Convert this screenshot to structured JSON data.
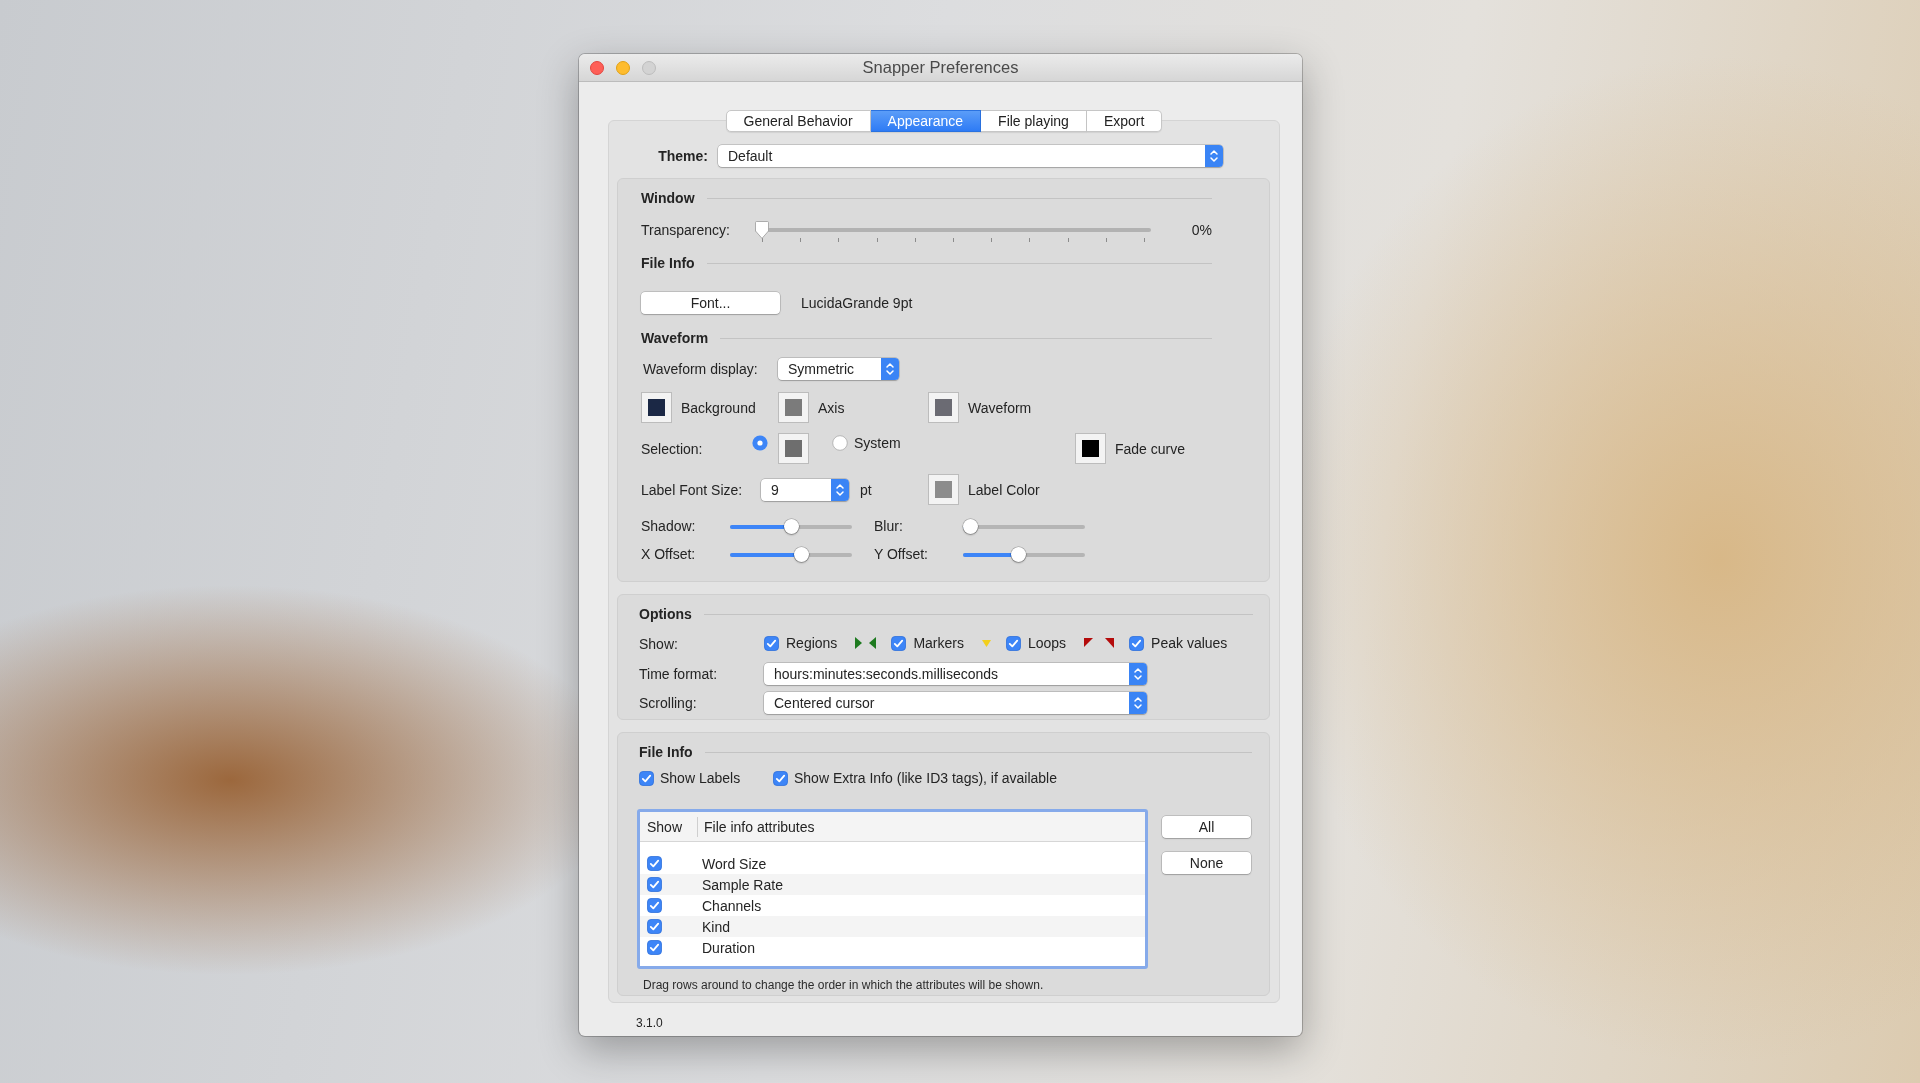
{
  "window": {
    "title": "Snapper Preferences",
    "controls": [
      {
        "kind": "close",
        "disabled": false
      },
      {
        "kind": "minimize",
        "disabled": false
      },
      {
        "kind": "zoom",
        "disabled": true
      }
    ],
    "version": "3.1.0"
  },
  "tabs": [
    {
      "label": "General Behavior",
      "selected": false
    },
    {
      "label": "Appearance",
      "selected": true
    },
    {
      "label": "File playing",
      "selected": false
    },
    {
      "label": "Export",
      "selected": false
    }
  ],
  "theme": {
    "label": "Theme:",
    "value": "Default"
  },
  "window_section": {
    "title": "Window",
    "transparency": {
      "label": "Transparency:",
      "level": 0,
      "reading": "0%"
    }
  },
  "font_section": {
    "title": "File Info",
    "button": "Font...",
    "font_name": "LucidaGrande 9pt"
  },
  "waveform_section": {
    "title": "Waveform",
    "display": {
      "label": "Waveform display:",
      "value": "Symmetric"
    },
    "colors": [
      {
        "label": "Background",
        "color": "#1b2845"
      },
      {
        "label": "Axis",
        "color": "#7b7b7b"
      },
      {
        "label": "Waveform",
        "color": "#6b6b73"
      }
    ],
    "selection": {
      "label": "Selection:",
      "options": [
        {
          "kind": "custom",
          "selected": true,
          "color": "#6e6e6e"
        },
        {
          "kind": "system",
          "label": "System",
          "selected": false
        }
      ]
    },
    "fade_curve": {
      "label": "Fade curve",
      "color": "#000000"
    },
    "label_font_size": {
      "label": "Label Font Size:",
      "value": "9",
      "unit": "pt"
    },
    "label_color": {
      "label": "Label Color",
      "color": "#8c8c8c"
    },
    "sliders": [
      {
        "label": "Shadow:",
        "level": 0.5
      },
      {
        "label": "Blur:",
        "level": 0
      },
      {
        "label": "X Offset:",
        "level": 0.6
      },
      {
        "label": "Y Offset:",
        "level": 0.45
      }
    ]
  },
  "options": {
    "title": "Options",
    "show": {
      "label": "Show:",
      "items": [
        {
          "kind": "regions",
          "label": "Regions",
          "checked": true
        },
        {
          "kind": "markers",
          "label": "Markers",
          "checked": true
        },
        {
          "kind": "loops",
          "label": "Loops",
          "checked": true
        },
        {
          "kind": "peaks",
          "label": "Peak values",
          "checked": true
        }
      ]
    },
    "time_format": {
      "label": "Time format:",
      "value": "hours:minutes:seconds.milliseconds"
    },
    "scrolling": {
      "label": "Scrolling:",
      "value": "Centered cursor"
    }
  },
  "file_info": {
    "title": "File Info",
    "checkboxes": [
      {
        "label": "Show Labels",
        "checked": true
      },
      {
        "label": "Show Extra Info (like ID3 tags), if available",
        "checked": true
      }
    ],
    "table": {
      "columns": [
        "Show",
        "File info attributes"
      ],
      "rows": [
        {
          "checked": true,
          "name": "Word Size"
        },
        {
          "checked": true,
          "name": "Sample Rate"
        },
        {
          "checked": true,
          "name": "Channels"
        },
        {
          "checked": true,
          "name": "Kind"
        },
        {
          "checked": true,
          "name": "Duration"
        }
      ]
    },
    "buttons": [
      "All",
      "None"
    ],
    "hint": "Drag rows around to change the order in which the attributes will be shown."
  }
}
